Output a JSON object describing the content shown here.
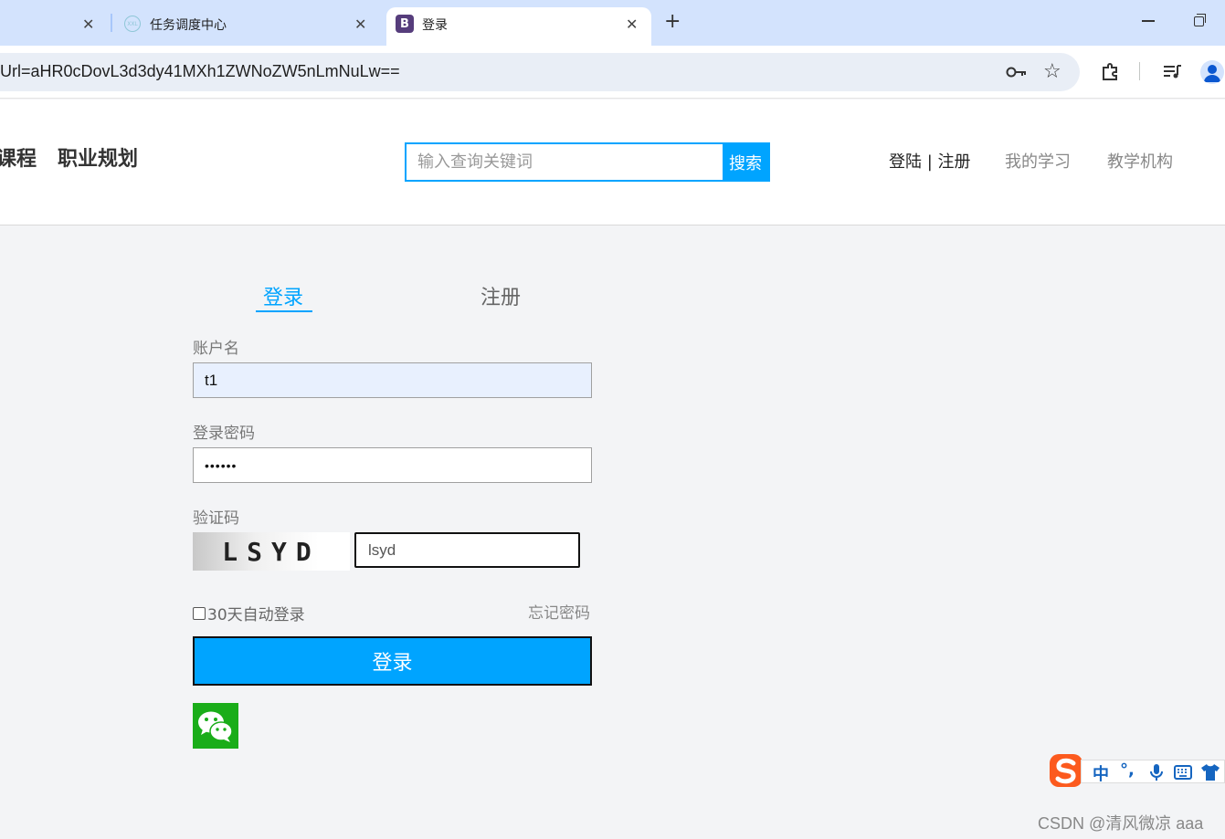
{
  "browser": {
    "tabs": [
      {
        "title": "",
        "active": false
      },
      {
        "title": "任务调度中心",
        "favicon": "xxl",
        "active": false
      },
      {
        "title": "登录",
        "favicon": "B",
        "active": true
      }
    ],
    "url": "Url=aHR0cDovL3d3dy41MXh1ZWNoZW5nLmNuLw=="
  },
  "header": {
    "nav": [
      "课程",
      "职业规划"
    ],
    "search_placeholder": "输入查询关键词",
    "search_button": "搜索",
    "login_register": "登陆 | 注册",
    "my_study": "我的学习",
    "institutions": "教学机构"
  },
  "login_form": {
    "tab_login": "登录",
    "tab_register": "注册",
    "username_label": "账户名",
    "username_value": "t1",
    "password_label": "登录密码",
    "password_value": "••••••",
    "captcha_label": "验证码",
    "captcha_image_text": "LSYD",
    "captcha_value": "lsyd",
    "remember_label": "30天自动登录",
    "forgot_label": "忘记密码",
    "submit_label": "登录"
  },
  "ime": {
    "mode": "中",
    "punct": "°,"
  },
  "watermark": "CSDN @清风微凉 aaa",
  "colors": {
    "accent": "#00a4ff",
    "wechat": "#1aad19",
    "tabbar": "#d3e3fd"
  }
}
